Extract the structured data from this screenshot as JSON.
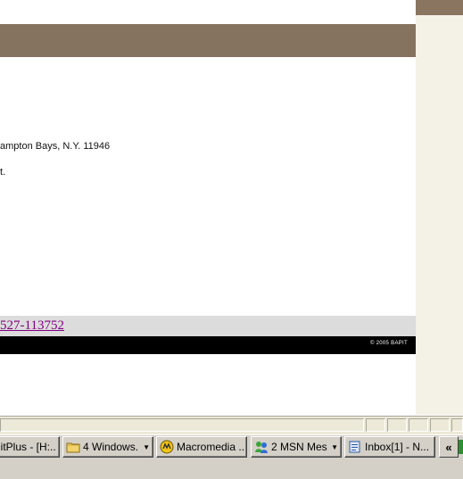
{
  "page": {
    "address_fragment": "ampton Bays, N.Y. 11946",
    "text_fragment": "t.",
    "link_text": "527-113752",
    "copyright": "© 2005 BAPIT"
  },
  "taskbar": {
    "buttons": [
      {
        "label": "litPlus - [H:...",
        "icon": "app-window-icon"
      },
      {
        "label": "4 Windows...",
        "icon": "folder-icon",
        "has_arrow": true
      },
      {
        "label": "Macromedia ...",
        "icon": "macromedia-icon"
      },
      {
        "label": "2 MSN Mes...",
        "icon": "msn-messenger-icon",
        "has_arrow": true
      },
      {
        "label": "Inbox[1] - N...",
        "icon": "mail-icon"
      }
    ],
    "overflow_label": "«"
  },
  "colors": {
    "header_band": "#85735f",
    "side_strip": "#f4f1e6",
    "link_visited": "#800080",
    "footer": "#000000"
  }
}
